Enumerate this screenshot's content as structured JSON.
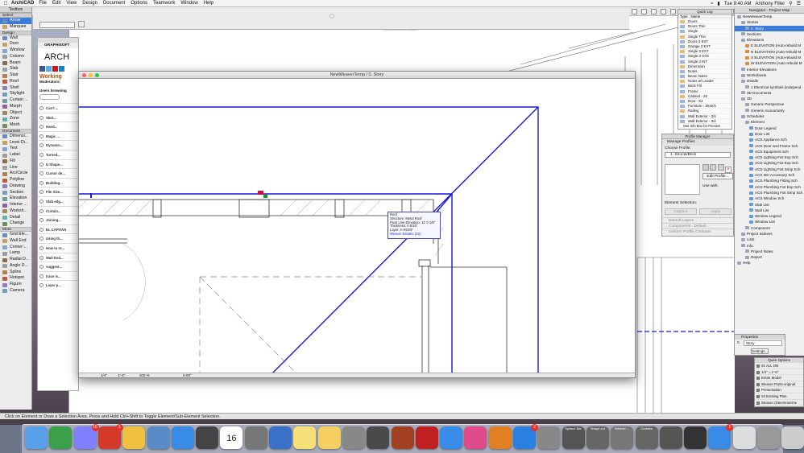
{
  "menubar": {
    "app": "ArchiCAD",
    "items": [
      "File",
      "Edit",
      "View",
      "Design",
      "Document",
      "Options",
      "Teamwork",
      "Window",
      "Help"
    ],
    "clock": "Tue 9:40 AM",
    "user": "Anthony Filler"
  },
  "toolbox": {
    "title": "Toolbox",
    "select_header": "Select",
    "select_items": [
      "Arrow",
      "Marquee"
    ],
    "design_header": "Design",
    "design_items": [
      "Wall",
      "Door",
      "Window",
      "Column",
      "Beam",
      "Slab",
      "Stair",
      "Roof",
      "Shell",
      "Skylight",
      "Curtain ...",
      "Morph",
      "Object",
      "Zone",
      "Mesh"
    ],
    "document_header": "Document",
    "document_items": [
      "Dimensi...",
      "Level Di...",
      "Text",
      "Label",
      "Fill",
      "Line",
      "Arc/Circle",
      "Polyline",
      "Drawing",
      "Section",
      "Elevation",
      "Interior ...",
      "Worksh...",
      "Detail",
      "Change"
    ],
    "more_header": "More",
    "more_items": [
      "Grid Ele...",
      "Wall End",
      "Corner-...",
      "Lamp",
      "Radial D...",
      "Angle D...",
      "Spline",
      "Hotspot",
      "Figure",
      "Camera"
    ]
  },
  "forum": {
    "brand": "GRAPHISOFT",
    "heading": "ARCH",
    "working": "Working",
    "moderators": "Moderators:",
    "users": "Users browsing",
    "threads": [
      "Can't ...",
      "Sket...",
      "Hand...",
      "Magic ...",
      "Dynamic...",
      "Turned...",
      "U Shape...",
      "Cursor de...",
      "Building...",
      "File Size...",
      "Slab edg...",
      "Curtain...",
      "Joining...",
      "EL CAPITAN",
      "Using th...",
      "How to re...",
      "Wall End...",
      "suggest...",
      "trace is...",
      "Layer p..."
    ]
  },
  "main_window": {
    "title": "NewWeaverTemp / 0. Story",
    "tooltip": {
      "line1": "Roof",
      "line2": "Structure: Metal Roof",
      "line3": "Pivot Line Elevation: 11' 0 1/8\"",
      "line4": "Thickness: 0 5/16\"",
      "line5": "Layer: A-ROOF",
      "line6": "Weaver Estates (2S)"
    },
    "status_fields": [
      "1/4\"",
      "1'-0\"",
      "100 %",
      "0.00°"
    ]
  },
  "back_window": {
    "title": "Axonometric Model"
  },
  "layer_panel": {
    "title": "Quick Lay",
    "header": [
      "Type",
      "Name"
    ],
    "rows": [
      "Doors",
      "Doors Thin",
      "Single",
      "Single Thin",
      "Doors 3 EXT",
      "Garage 3 EXT",
      "Single 3 EXT",
      "Single 3 OAK",
      "Single 3 INT",
      "Dimension",
      "Notes",
      "Beam Notes",
      "Notes w/ Leader",
      "Brick Fill",
      "Frame",
      "Cabinet - 25",
      "Door - 54",
      "Furniture - Sketch",
      "Railing",
      "Wall Exterior - 3/4",
      "Wall Exterior - 3/4"
    ],
    "footer": "See Info Box for Preview"
  },
  "navigator": {
    "title": "Navigator - Project Map",
    "rows": [
      "NewWeaverTemp",
      "Stories",
      "0. Story",
      "Sections",
      "Elevations",
      "E ELEVATION (Auto-rebuild M",
      "N ELEVATION (Auto-rebuild M",
      "S ELEVATION (Auto-rebuild M",
      "W ELEVATION (Auto-rebuild M",
      "Interior Elevations",
      "Worksheets",
      "Details",
      "1 Electrical symbols (independ",
      "3D Documents",
      "3D",
      "Generic Perspective",
      "Generic Axonometry",
      "Schedules",
      "Element",
      "Door Legend",
      "Door List",
      "ACS Appliance Sch",
      "ACS Door and Frame Sch",
      "ACS Equipment Sch",
      "ACS Lighting Fixt Exp Sch",
      "ACS Lighting Fixt Exp Sch",
      "ACS Lighting Fixt Simp Sch",
      "ACS MH Accessory Sch",
      "ACS Plumbing Fitting Sch",
      "ACS Plumbing Fixt Exp Sch",
      "ACS Plumbing Fixt Simp Sch",
      "ACS Window Sch",
      "Slab List",
      "Wall List",
      "Window Legend",
      "Window List",
      "Component",
      "Project Indexes",
      "Lists",
      "Info",
      "Project Notes",
      "Report",
      "Help"
    ]
  },
  "profile_manager": {
    "title": "Profile Manager",
    "header": "Manage Profiles",
    "choose": "Choose Profile:",
    "selected": "1. Structs/Brick",
    "edit": "Edit Profile...",
    "use_with": "Use with:",
    "element_selection": "Element Selection:",
    "capture": "Capture",
    "apply": "Apply",
    "sections": [
      "Default Layers",
      "Components - Default",
      "Uniform Profile Contours"
    ]
  },
  "properties": {
    "title": "Properties",
    "story_num": "0.",
    "story_name": "Story",
    "settings": "Settings..."
  },
  "quick_options": {
    "title": "Quick Options",
    "rows": [
      "01 ALL ON",
      "1/4\"  =  1'-0\"",
      "Entire Model",
      "Weaver Parts-original",
      "Presentation",
      "03 Existing Plan",
      "Weaver (Steemmerme"
    ]
  },
  "status_bar": {
    "text": "Click on Element or Draw a Selection Area. Press and Hold Ctrl+Shift to Toggle Element/Sub-Element Selection."
  },
  "dock": {
    "apps": [
      "Finder",
      "Numbers",
      "Calendar Grid",
      "SketchUp",
      "Photos",
      "Preview",
      "Safari",
      "GIMP",
      "Calendar",
      "Launchpad",
      "Keynote",
      "Notefile",
      "Notes",
      "Preview2",
      "Music Studio",
      "Camera",
      "Pinterest",
      "Mail Upload",
      "iTunes",
      "iBooks",
      "App Store",
      "System Preferences",
      "Screenshot 1",
      "Screenshot 2",
      "Screenshot 3",
      "Screenshot 4",
      "Screenshot 5",
      "Activity Monitor",
      "Messages",
      "Finder Window",
      "Empty Space",
      "Trash"
    ],
    "calendar_day": "16",
    "badges": {
      "calendar_grid": "16",
      "sketchup": "1",
      "app_store": "2",
      "messages": "1"
    },
    "labels": [
      "Spllace Bar",
      "Shape cut",
      "Weaver ...",
      "Crosses"
    ]
  },
  "colors": {
    "accent_blue": "#1a1aff",
    "roof_line": "#1818d6",
    "menu_bg": "#f3f3f3"
  }
}
